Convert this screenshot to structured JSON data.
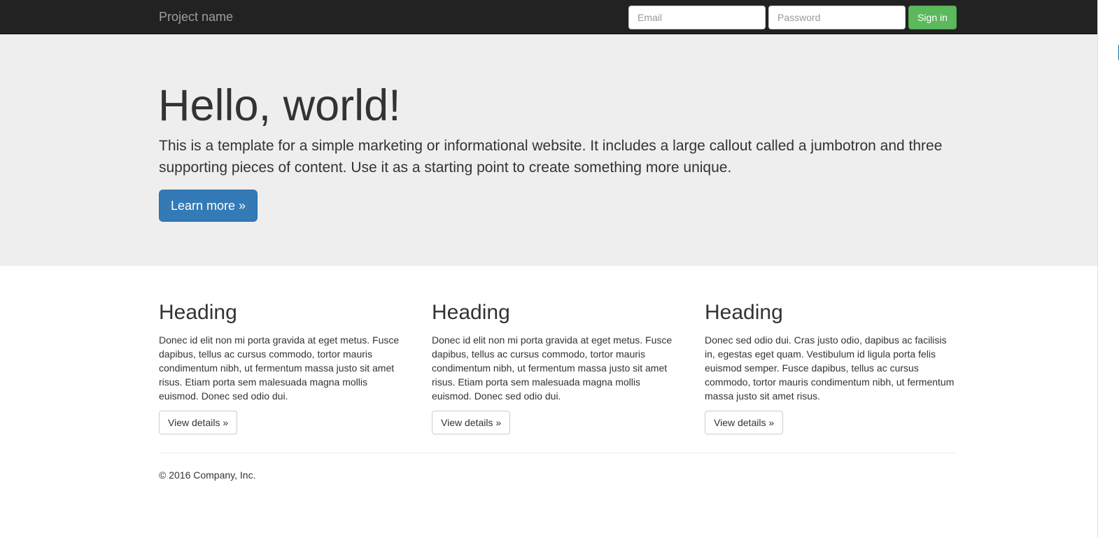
{
  "navbar": {
    "brand": "Project name",
    "email_placeholder": "Email",
    "password_placeholder": "Password",
    "signin_label": "Sign in"
  },
  "jumbotron": {
    "title": "Hello, world!",
    "text": "This is a template for a simple marketing or informational website. It includes a large callout called a jumbotron and three supporting pieces of content. Use it as a starting point to create something more unique.",
    "button_label": "Learn more »"
  },
  "columns": [
    {
      "heading": "Heading",
      "text": "Donec id elit non mi porta gravida at eget metus. Fusce dapibus, tellus ac cursus commodo, tortor mauris condimentum nibh, ut fermentum massa justo sit amet risus. Etiam porta sem malesuada magna mollis euismod. Donec sed odio dui.",
      "button_label": "View details »"
    },
    {
      "heading": "Heading",
      "text": "Donec id elit non mi porta gravida at eget metus. Fusce dapibus, tellus ac cursus commodo, tortor mauris condimentum nibh, ut fermentum massa justo sit amet risus. Etiam porta sem malesuada magna mollis euismod. Donec sed odio dui.",
      "button_label": "View details »"
    },
    {
      "heading": "Heading",
      "text": "Donec sed odio dui. Cras justo odio, dapibus ac facilisis in, egestas eget quam. Vestibulum id ligula porta felis euismod semper. Fusce dapibus, tellus ac cursus commodo, tortor mauris condimentum nibh, ut fermentum massa justo sit amet risus.",
      "button_label": "View details »"
    }
  ],
  "footer": {
    "copyright": "© 2016 Company, Inc."
  },
  "colors": {
    "navbar_bg": "#222222",
    "jumbotron_bg": "#eeeeee",
    "primary": "#337ab7",
    "success": "#5cb85c"
  }
}
